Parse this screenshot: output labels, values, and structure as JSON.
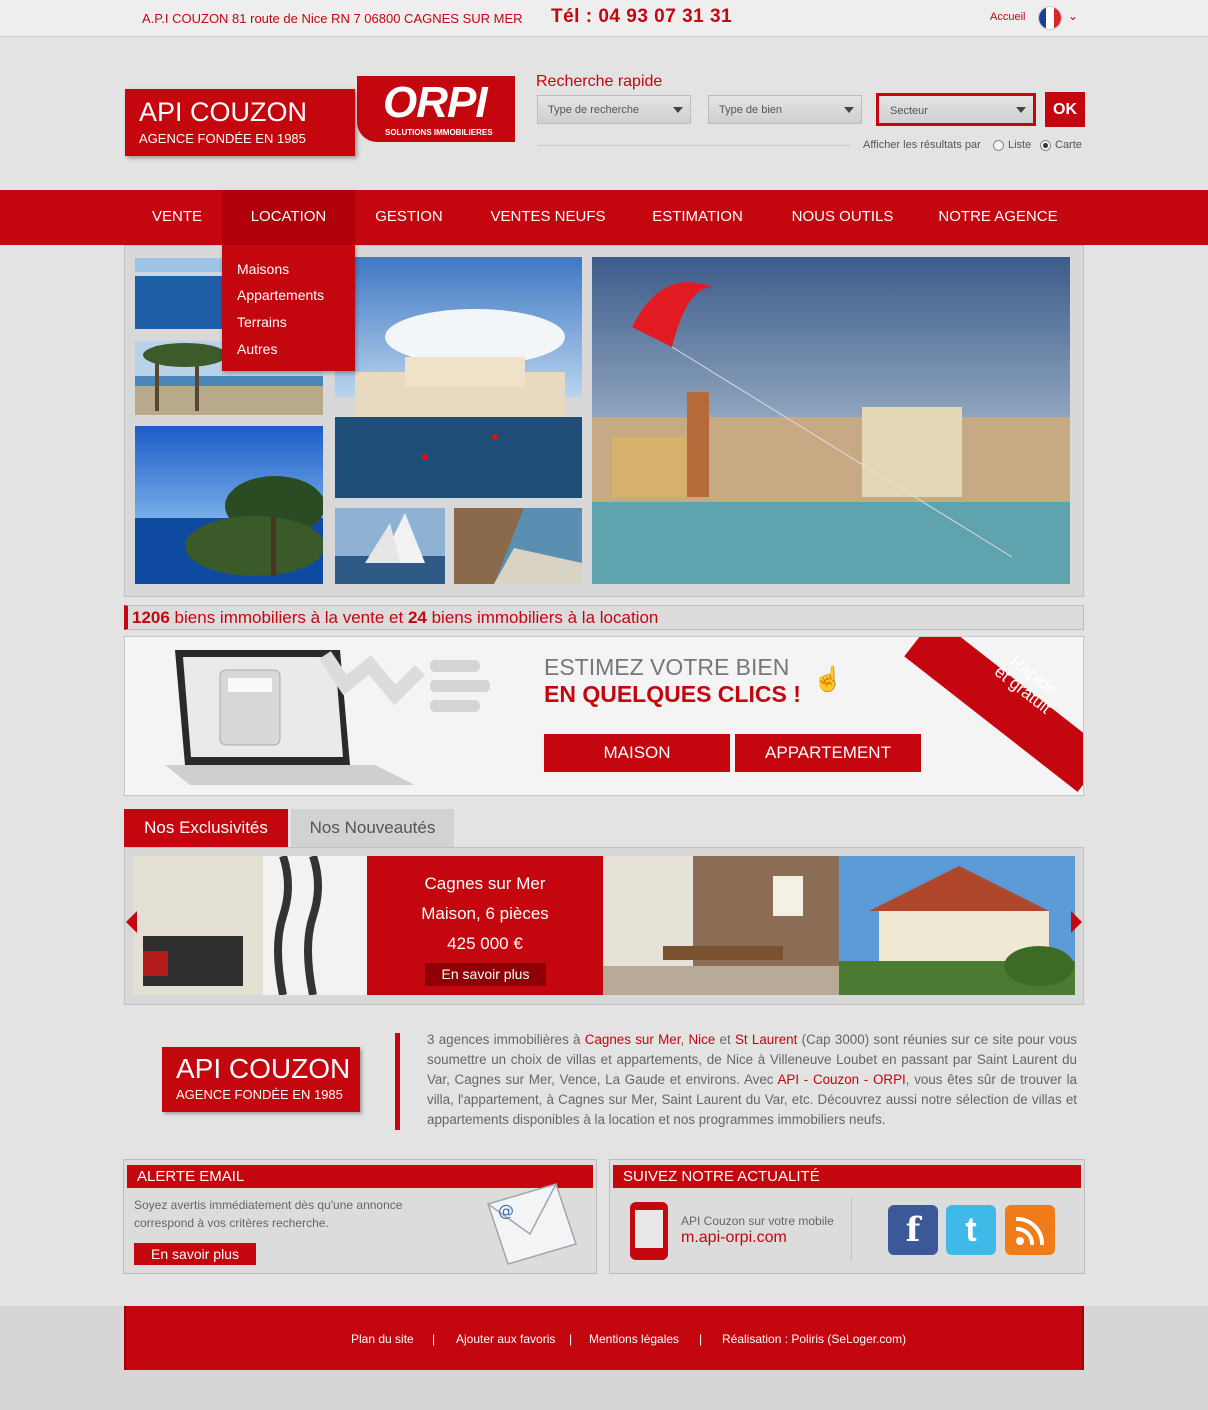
{
  "topbar": {
    "address": "A.P.I COUZON 81 route de Nice RN 7 06800 CAGNES SUR MER",
    "phone": "Tél : 04 93 07 31 31",
    "home": "Accueil"
  },
  "logo": {
    "name": "API COUZON",
    "tagline": "AGENCE FONDÉE EN 1985",
    "brand": "ORPI",
    "brand_sub": "SOLUTIONS IMMOBILIERES"
  },
  "search": {
    "title": "Recherche rapide",
    "type_search": "Type de recherche",
    "type_property": "Type de bien",
    "sector": "Secteur",
    "ok": "OK",
    "display_label": "Afficher les résultats par",
    "list": "Liste",
    "map": "Carte"
  },
  "nav": [
    "VENTE",
    "LOCATION",
    "GESTION",
    "VENTES NEUFS",
    "ESTIMATION",
    "NOUS OUTILS",
    "NOTRE AGENCE"
  ],
  "dropdown": [
    "Maisons",
    "Appartements",
    "Terrains",
    "Autres"
  ],
  "counts": {
    "sale_count": "1206",
    "sale_text": " biens immobiliers à la vente et ",
    "rent_count": "24",
    "rent_text": " biens immobiliers à la location"
  },
  "estimate": {
    "line1": "ESTIMEZ VOTRE BIEN",
    "line2": "EN QUELQUES CLICS !",
    "house": "MAISON",
    "apartment": "APPARTEMENT",
    "ribbon1": "Rapide",
    "ribbon2": "et gratuit"
  },
  "tabs": {
    "exclusives": "Nos Exclusivités",
    "news": "Nos Nouveautés"
  },
  "card": {
    "city": "Cagnes sur Mer",
    "type": "Maison, 6 pièces",
    "price": "425 000 €",
    "more": "En savoir plus"
  },
  "about": {
    "name": "API COUZON",
    "tagline": "AGENCE FONDÉE EN 1985",
    "p1": "3 agences immobilières à ",
    "l1": "Cagnes sur Mer",
    "p2": ", ",
    "l2": "Nice",
    "p3": " et ",
    "l3": "St Laurent",
    "p4": " (Cap 3000) sont réunies sur ce site pour vous soumettre un choix de villas et appartements, de Nice à Villeneuve Loubet en passant par Saint Laurent du Var, Cagnes sur Mer, Vence, La Gaude et environs. Avec ",
    "l4": "API - Couzon - ORPI",
    "p5": ", vous êtes sûr de trouver la villa, l'appartement, à Cagnes sur Mer, Saint Laurent du Var, etc. Découvrez aussi notre sélection de villas et appartements disponibles à la location et nos programmes immobiliers neufs."
  },
  "alert": {
    "title": "ALERTE EMAIL",
    "text": "Soyez avertis immédiatement dès qu'une annonce correspond à vos critères recherche.",
    "button": "En savoir plus"
  },
  "follow": {
    "title": "SUIVEZ NOTRE ACTUALITÉ",
    "mobile_text": "API Couzon sur votre mobile",
    "mobile_url": "m.api-orpi.com"
  },
  "footer": {
    "sitemap": "Plan du site",
    "favorites": "Ajouter aux favoris",
    "legal": "Mentions légales",
    "credit": "Réalisation : Poliris (SeLoger.com)",
    "sep": "|"
  },
  "colors": {
    "brand_red": "#c4060f",
    "background": "#e3e3e3"
  }
}
